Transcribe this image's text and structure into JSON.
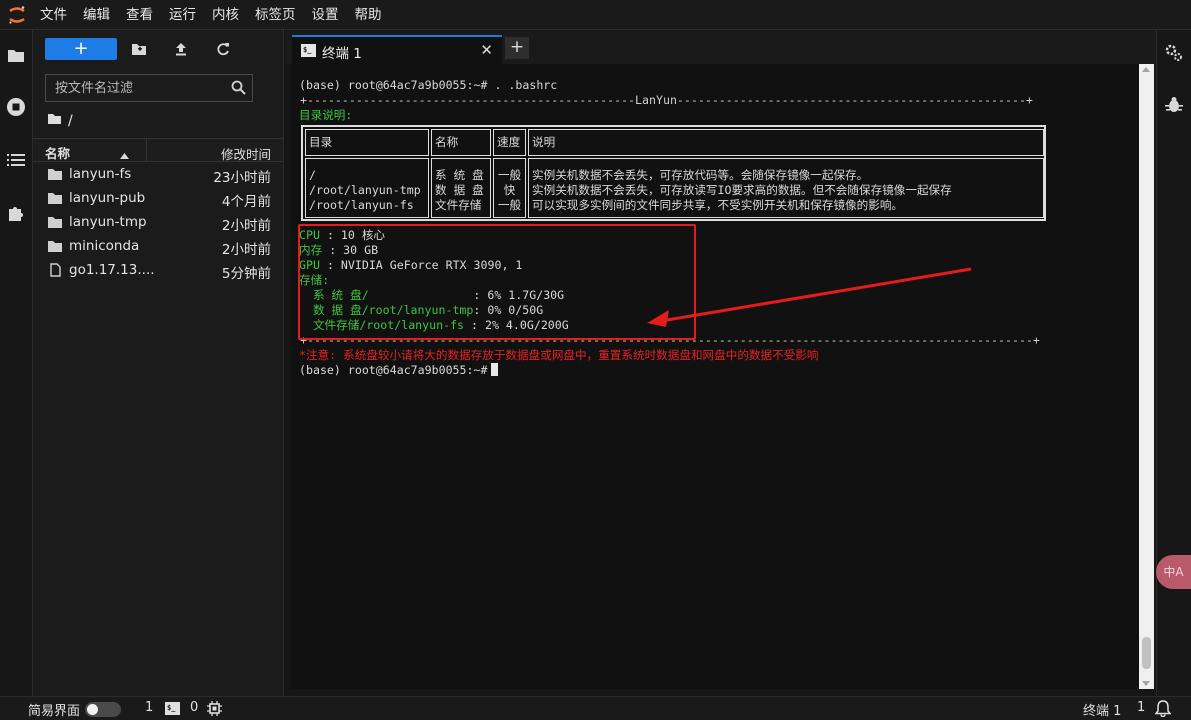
{
  "menubar": {
    "items": [
      "文件",
      "编辑",
      "查看",
      "运行",
      "内核",
      "标签页",
      "设置",
      "帮助"
    ]
  },
  "filebrowser": {
    "new_label": "+",
    "search_placeholder": "按文件名过滤",
    "path": "/",
    "header_name": "名称",
    "header_modified": "修改时间",
    "files": [
      {
        "name": "lanyun-fs",
        "modified": "23小时前",
        "icon": "folder-icon"
      },
      {
        "name": "lanyun-pub",
        "modified": "4个月前",
        "icon": "folder-icon"
      },
      {
        "name": "lanyun-tmp",
        "modified": "2小时前",
        "icon": "folder-icon"
      },
      {
        "name": "miniconda",
        "modified": "2小时前",
        "icon": "folder-icon"
      },
      {
        "name": "go1.17.13....",
        "modified": "5分钟前",
        "icon": "file-icon"
      }
    ]
  },
  "tabs": [
    {
      "label": "终端 1",
      "active": true,
      "icon": "terminal-icon"
    }
  ],
  "terminal": {
    "prompt_cmd": "(base) root@64ac7a9b0055:~# . .bashrc",
    "banner_top": "+-----------------------------------------------LanYun--------------------------------------------------+",
    "dir_label": "目录说明:",
    "table": {
      "headers": [
        "目录",
        "名称",
        "速度",
        "说明"
      ],
      "paths": [
        "/",
        "/root/lanyun-tmp",
        "/root/lanyun-fs"
      ],
      "names": [
        "系 统 盘",
        "数 据 盘",
        "文件存储"
      ],
      "speeds": [
        "一般",
        "快",
        "一般"
      ],
      "descs": [
        "实例关机数据不会丢失，可存放代码等。会随保存镜像一起保存。",
        "实例关机数据不会丢失，可存放读写IO要求高的数据。但不会随保存镜像一起保存",
        "可以实现多实例间的文件同步共享，不受实例开关机和保存镜像的影响。"
      ]
    },
    "cpu_label": "CPU",
    "cpu_value": ": 10 核心",
    "mem_label": "内存",
    "mem_value": ": 30 GB",
    "gpu_label": "GPU",
    "gpu_value": ": NVIDIA GeForce RTX 3090, 1",
    "storage_label": "存储:",
    "storage": [
      {
        "label": "  系 统 盘/               ",
        "value": ": 6% 1.7G/30G"
      },
      {
        "label": "  数 据 盘/root/lanyun-tmp",
        "value": ": 0% 0/50G"
      },
      {
        "label": "  文件存储/root/lanyun-fs ",
        "value": ": 2% 4.0G/200G"
      }
    ],
    "banner_bottom": "+--------------------------------------------------------------------------------------------------------+",
    "notice": "*注意: 系统盘较小请将大的数据存放于数据盘或网盘中，重置系统时数据盘和网盘中的数据不受影响",
    "prompt_final": "(base) root@64ac7a9b0055:~#"
  },
  "statusbar": {
    "simple_mode_label": "简易界面",
    "kernels_count": "1",
    "terminals_count": "0",
    "active_label": "终端 1",
    "notif_count": "1"
  },
  "colors": {
    "accent": "#1e7ce6",
    "terminal_green": "#3ec43e",
    "terminal_red": "#e42222",
    "highlight_red": "#e51c1c",
    "translate_pink": "#b85a6a"
  }
}
